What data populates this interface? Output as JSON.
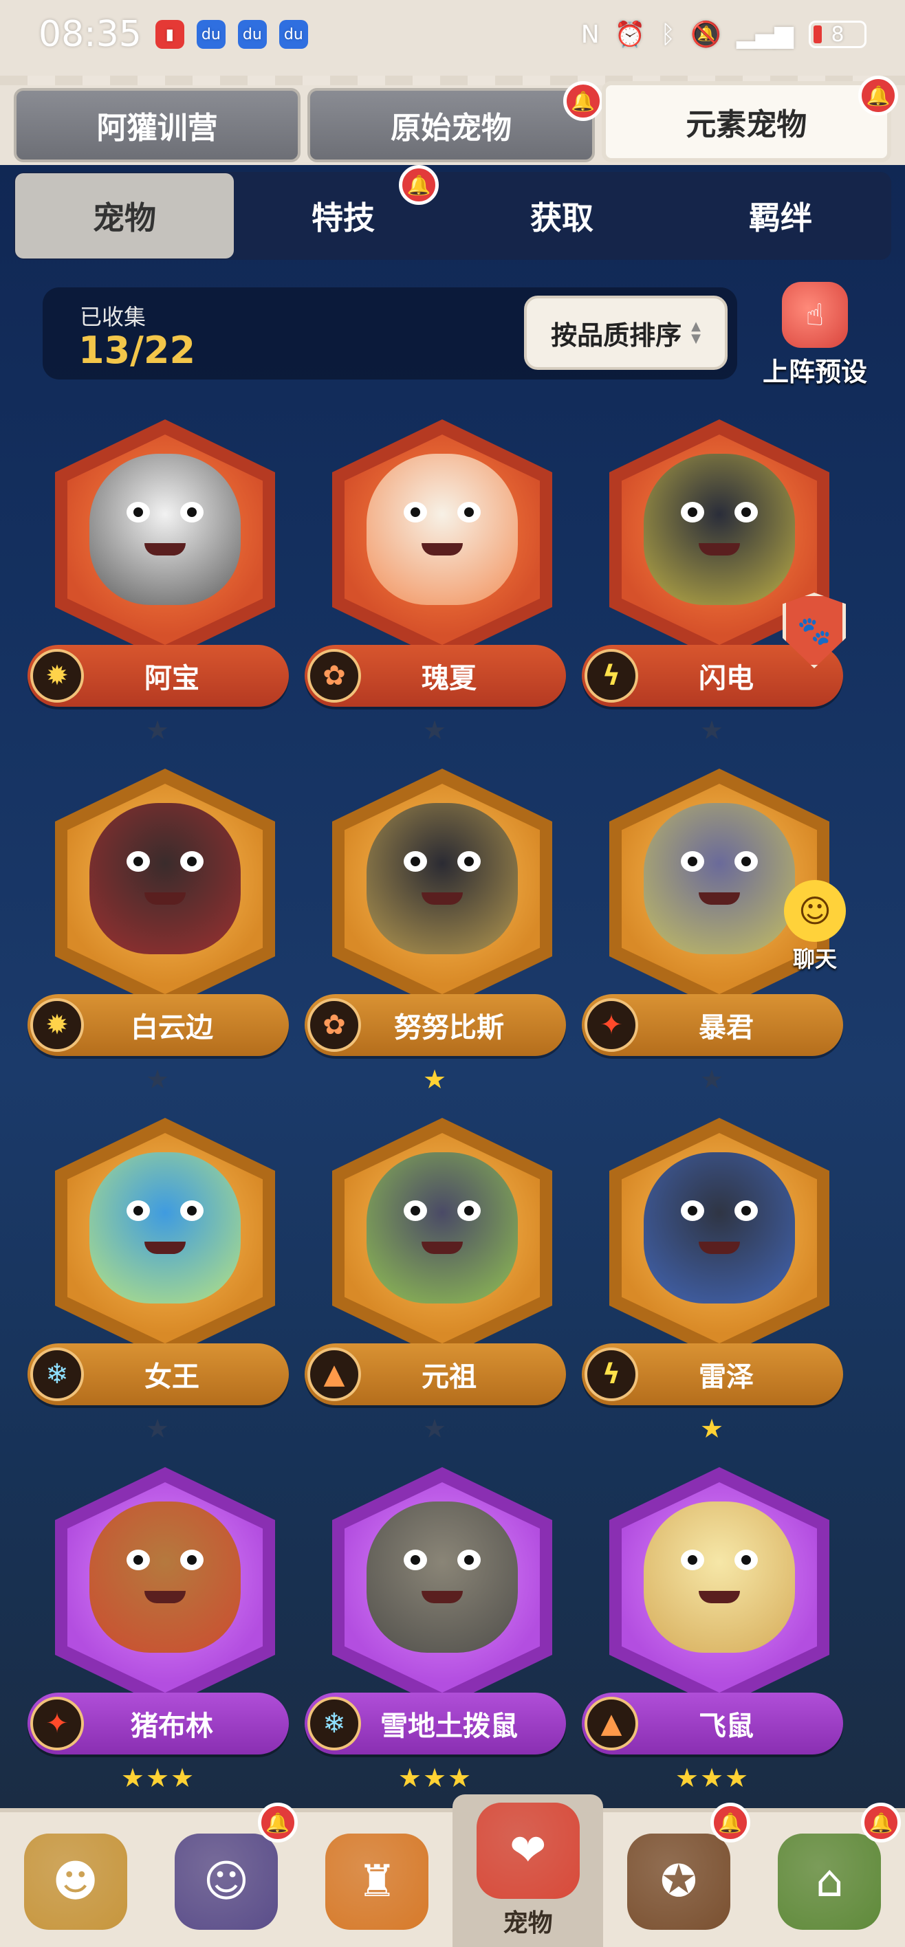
{
  "status_bar": {
    "time": "08:35",
    "battery": "8"
  },
  "top_tabs": [
    {
      "label": "阿獾训营",
      "active": false,
      "notify": false
    },
    {
      "label": "原始宠物",
      "active": false,
      "notify": true
    },
    {
      "label": "元素宠物",
      "active": true,
      "notify": true
    }
  ],
  "sub_tabs": [
    {
      "label": "宠物",
      "active": true,
      "notify": false
    },
    {
      "label": "特技",
      "active": false,
      "notify": true
    },
    {
      "label": "获取",
      "active": false,
      "notify": false
    },
    {
      "label": "羁绊",
      "active": false,
      "notify": false
    }
  ],
  "collection": {
    "label": "已收集",
    "count": "13/22",
    "sort_label": "按品质排序",
    "preset_label": "上阵预设"
  },
  "chat": {
    "label": "聊天"
  },
  "pets": [
    {
      "name": "阿宝",
      "tier": "red",
      "element": "gold",
      "element_glyph": "✹",
      "stars": 1,
      "star_color": "dim",
      "body": "#f2f2f2",
      "accent": "#222"
    },
    {
      "name": "瑰夏",
      "tier": "red",
      "element": "brown",
      "element_glyph": "✿",
      "stars": 1,
      "star_color": "dim",
      "body": "#f7f1e6",
      "accent": "#f06a24"
    },
    {
      "name": "闪电",
      "tier": "red",
      "element": "yellow",
      "element_glyph": "ϟ",
      "stars": 1,
      "star_color": "dim",
      "body": "#2a2d3a",
      "accent": "#f5e04a"
    },
    {
      "name": "白云边",
      "tier": "orange",
      "element": "gold",
      "element_glyph": "✹",
      "stars": 1,
      "star_color": "dim",
      "body": "#3a2c2c",
      "accent": "#c23232"
    },
    {
      "name": "努努比斯",
      "tier": "orange",
      "element": "brown",
      "element_glyph": "✿",
      "stars": 1,
      "star_color": "gold",
      "body": "#2b2b33",
      "accent": "#e8c25a"
    },
    {
      "name": "暴君",
      "tier": "orange",
      "element": "fire",
      "element_glyph": "✦",
      "stars": 1,
      "star_color": "dim",
      "body": "#6a6a9a",
      "accent": "#e8e04a"
    },
    {
      "name": "女王",
      "tier": "orange",
      "element": "ice",
      "element_glyph": "❄",
      "stars": 1,
      "star_color": "dim",
      "body": "#3f9be0",
      "accent": "#e6ff5a"
    },
    {
      "name": "元祖",
      "tier": "orange",
      "element": "earth",
      "element_glyph": "▲",
      "stars": 1,
      "star_color": "dim",
      "body": "#4a4a66",
      "accent": "#aef04a"
    },
    {
      "name": "雷泽",
      "tier": "orange",
      "element": "yellow",
      "element_glyph": "ϟ",
      "stars": 1,
      "star_color": "gold",
      "body": "#2f3544",
      "accent": "#4a78e0"
    },
    {
      "name": "猪布林",
      "tier": "purple",
      "element": "fire",
      "element_glyph": "✦",
      "stars": 3,
      "star_color": "gold",
      "body": "#b5793e",
      "accent": "#d63a2a"
    },
    {
      "name": "雪地土拨鼠",
      "tier": "purple",
      "element": "ice",
      "element_glyph": "❄",
      "stars": 3,
      "star_color": "gold",
      "body": "#8a8577",
      "accent": "#3a3a3a"
    },
    {
      "name": "飞鼠",
      "tier": "purple",
      "element": "earth",
      "element_glyph": "▲",
      "stars": 3,
      "star_color": "gold",
      "body": "#f6e7a8",
      "accent": "#c9943a"
    }
  ],
  "bottom_nav": [
    {
      "name": "nav-warrior",
      "label": "",
      "color": "#c7963d",
      "glyph": "☻",
      "active": false,
      "notify": false
    },
    {
      "name": "nav-hero",
      "label": "",
      "color": "#5a4d8a",
      "glyph": "☺",
      "active": false,
      "notify": true
    },
    {
      "name": "nav-totem",
      "label": "",
      "color": "#d77a2a",
      "glyph": "♜",
      "active": false,
      "notify": false
    },
    {
      "name": "nav-pets",
      "label": "宠物",
      "color": "#d94a3a",
      "glyph": "❤",
      "active": true,
      "notify": false
    },
    {
      "name": "nav-bear",
      "label": "",
      "color": "#7a5030",
      "glyph": "✪",
      "active": false,
      "notify": true
    },
    {
      "name": "nav-building",
      "label": "",
      "color": "#5f8a3a",
      "glyph": "⌂",
      "active": false,
      "notify": true
    }
  ]
}
